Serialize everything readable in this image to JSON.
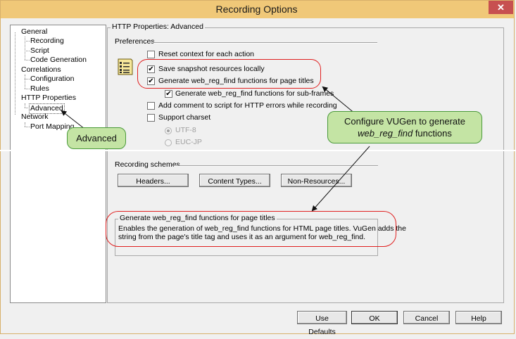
{
  "window": {
    "title": "Recording Options",
    "close_label": "✕"
  },
  "tree": {
    "items": [
      {
        "label": "General",
        "level": 0
      },
      {
        "label": "Recording",
        "level": 1
      },
      {
        "label": "Script",
        "level": 1
      },
      {
        "label": "Code Generation",
        "level": 1
      },
      {
        "label": "Correlations",
        "level": 0
      },
      {
        "label": "Configuration",
        "level": 1
      },
      {
        "label": "Rules",
        "level": 1
      },
      {
        "label": "HTTP Properties",
        "level": 0
      },
      {
        "label": "Advanced",
        "level": 1,
        "selected": true
      },
      {
        "label": "Network",
        "level": 0
      },
      {
        "label": "Port Mapping",
        "level": 1
      }
    ]
  },
  "panel": {
    "title": "HTTP Properties: Advanced",
    "preferences_label": "Preferences",
    "preferences_icon": "settings-list-icon",
    "options": [
      {
        "label": "Reset context for each action",
        "checked": false
      },
      {
        "label": "Save snapshot resources locally",
        "checked": true
      },
      {
        "label": "Generate web_reg_find functions for page titles",
        "checked": true
      },
      {
        "label": "Generate web_reg_find functions for sub-frames",
        "checked": true
      },
      {
        "label": "Add comment to script for HTTP errors while recording",
        "checked": false
      },
      {
        "label": "Support charset",
        "checked": false
      }
    ],
    "charsets": [
      {
        "label": "UTF-8",
        "selected": true
      },
      {
        "label": "EUC-JP",
        "selected": false
      }
    ],
    "schemes_label": "Recording schemes",
    "schemes_buttons": {
      "headers": "Headers...",
      "content_types": "Content Types...",
      "non_resources": "Non-Resources..."
    },
    "help": {
      "title": "Generate web_reg_find functions for page titles",
      "line1": "Enables the generation of web_reg_find functions for HTML page titles. VuGen adds the",
      "line2": "string from the page's title tag and uses it as an argument for web_reg_find."
    }
  },
  "footer": {
    "use_defaults": "Use Defaults",
    "ok": "OK",
    "cancel": "Cancel",
    "help": "Help"
  },
  "callouts": {
    "advanced": "Advanced",
    "configure_line1": "Configure VUGen to generate",
    "configure_em": "web_reg_find",
    "configure_rest": " functions"
  },
  "colors": {
    "titlebar": "#f0c878",
    "close": "#c75050",
    "callout_fill": "#c4e4a4",
    "callout_border": "#4a9a3a",
    "highlight_ring": "#e02020"
  }
}
